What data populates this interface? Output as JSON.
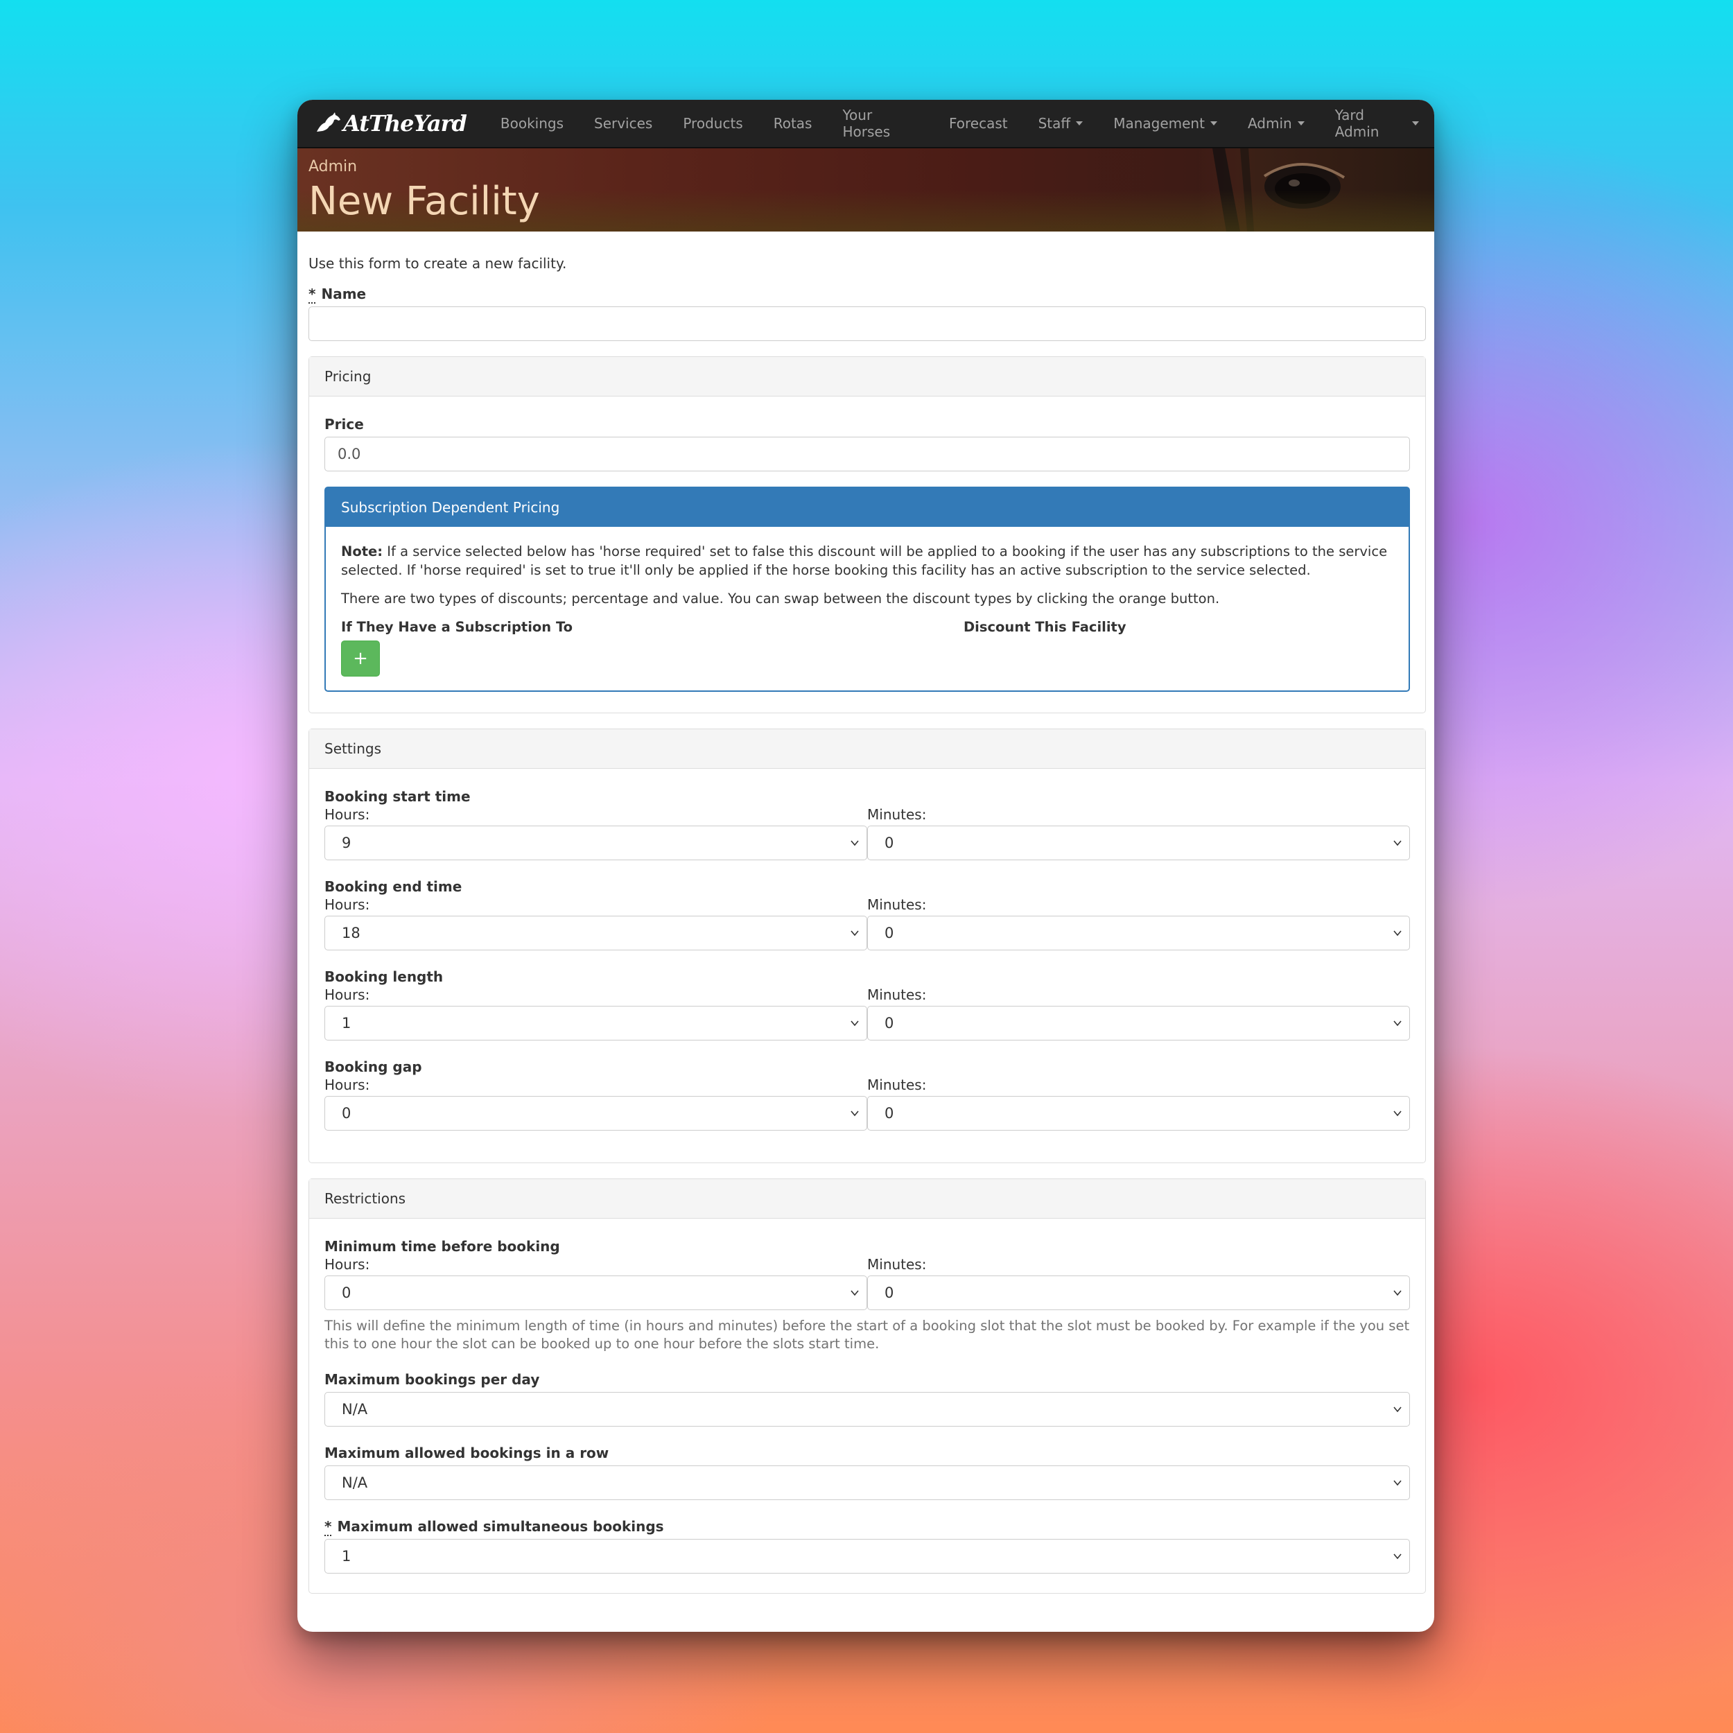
{
  "nav": {
    "brand": "AtTheYard",
    "items": [
      {
        "label": "Bookings",
        "dropdown": false
      },
      {
        "label": "Services",
        "dropdown": false
      },
      {
        "label": "Products",
        "dropdown": false
      },
      {
        "label": "Rotas",
        "dropdown": false
      },
      {
        "label": "Your Horses",
        "dropdown": false
      },
      {
        "label": "Forecast",
        "dropdown": false
      },
      {
        "label": "Staff",
        "dropdown": true
      },
      {
        "label": "Management",
        "dropdown": true
      },
      {
        "label": "Admin",
        "dropdown": true
      },
      {
        "label": "Yard Admin",
        "dropdown": true
      }
    ]
  },
  "header": {
    "breadcrumb": "Admin",
    "title": "New Facility"
  },
  "form": {
    "intro": "Use this form to create a new facility.",
    "required_mark": "*",
    "name_label": "Name",
    "name_value": ""
  },
  "pricing": {
    "heading": "Pricing",
    "price_label": "Price",
    "price_value": "0.0",
    "sub": {
      "heading": "Subscription Dependent Pricing",
      "note_bold": "Note:",
      "note_text": " If a service selected below has 'horse required' set to false this discount will be applied to a booking if the user has any subscriptions to the service selected. If 'horse required' is set to true it'll only be applied if the horse booking this facility has an active subscription to the service selected.",
      "types_text": "There are two types of discounts; percentage and value. You can swap between the discount types by clicking the orange button.",
      "col1": "If They Have a Subscription To",
      "col2": "Discount This Facility",
      "add_label": "+"
    }
  },
  "settings": {
    "heading": "Settings",
    "hours_label": "Hours:",
    "minutes_label": "Minutes:",
    "groups": [
      {
        "label": "Booking start time",
        "hours": "9",
        "minutes": "0"
      },
      {
        "label": "Booking end time",
        "hours": "18",
        "minutes": "0"
      },
      {
        "label": "Booking length",
        "hours": "1",
        "minutes": "0"
      },
      {
        "label": "Booking gap",
        "hours": "0",
        "minutes": "0"
      }
    ]
  },
  "restrictions": {
    "heading": "Restrictions",
    "min_time": {
      "label": "Minimum time before booking",
      "hours_label": "Hours:",
      "minutes_label": "Minutes:",
      "hours": "0",
      "minutes": "0",
      "help": "This will define the minimum length of time (in hours and minutes) before the start of a booking slot that the slot must be booked by. For example if the you set this to one hour the slot can be booked up to one hour before the slots start time."
    },
    "max_per_day": {
      "label": "Maximum bookings per day",
      "value": "N/A"
    },
    "max_in_row": {
      "label": "Maximum allowed bookings in a row",
      "value": "N/A"
    },
    "max_simultaneous": {
      "label": "Maximum allowed simultaneous bookings",
      "value": "1"
    }
  }
}
